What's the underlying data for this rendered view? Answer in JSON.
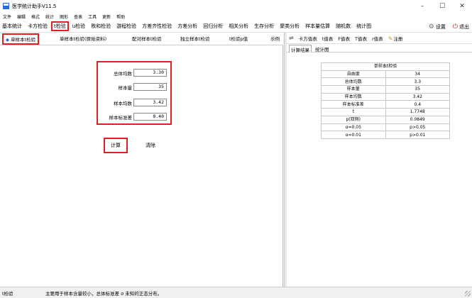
{
  "window": {
    "title": "医学统计助手V11.5",
    "minimize": "–",
    "maximize": "☐",
    "close": "✕"
  },
  "menu": [
    "文件",
    "编辑",
    "格式",
    "统计",
    "图形",
    "查表",
    "工具",
    "更新",
    "帮助"
  ],
  "toolbar": {
    "items": [
      "基本统计",
      "卡方检验",
      "t检验",
      "u检验",
      "秩和检验",
      "游程检验",
      "方差齐性检验",
      "方差分析",
      "回归分析",
      "相关分析",
      "生存分析",
      "聚类分析",
      "样本量估算",
      "随机数",
      "统计图"
    ],
    "settings_label": "设置",
    "exit_label": "退出"
  },
  "left_tabs": {
    "active": "单样本t检验",
    "items": [
      "单样本t检验(原始资料)",
      "配对样本t检验",
      "独立样本t检验",
      "t检验p值",
      "示例"
    ]
  },
  "form": {
    "fields": [
      {
        "label": "总体均数",
        "value": "3.30"
      },
      {
        "label": "样本量",
        "value": "35"
      },
      {
        "label": "样本均数",
        "value": "3.42"
      },
      {
        "label": "样本标准差",
        "value": "0.40"
      }
    ],
    "calc_button": "计算",
    "clear_button": "清除"
  },
  "right_toolbar": {
    "swap_icon": "⇌",
    "items": [
      "卡方值表",
      "t值表",
      "F值表",
      "T值表",
      "r值表"
    ],
    "note": "注册"
  },
  "right_tabs": [
    "计算结果",
    "统计图"
  ],
  "results": {
    "title": "单样本t检验",
    "rows": [
      {
        "label": "自由度",
        "value": "34"
      },
      {
        "label": "总体均数",
        "value": "3.3"
      },
      {
        "label": "样本量",
        "value": "35"
      },
      {
        "label": "样本均数",
        "value": "3.42"
      },
      {
        "label": "样本标准差",
        "value": "0.4"
      },
      {
        "label": "t",
        "value": "1.7748"
      },
      {
        "label": "p(双侧)",
        "value": "0.0849"
      },
      {
        "label": "α=0.05",
        "value": "p>0.05"
      },
      {
        "label": "α=0.01",
        "value": "p>0.01"
      }
    ]
  },
  "status": {
    "mode": "t检验",
    "message": "主要用于样本含量较小，总体标准差 σ 未知的正态分布。"
  },
  "colors": {
    "highlight": "#e02020",
    "accent": "#2a6bd8"
  }
}
